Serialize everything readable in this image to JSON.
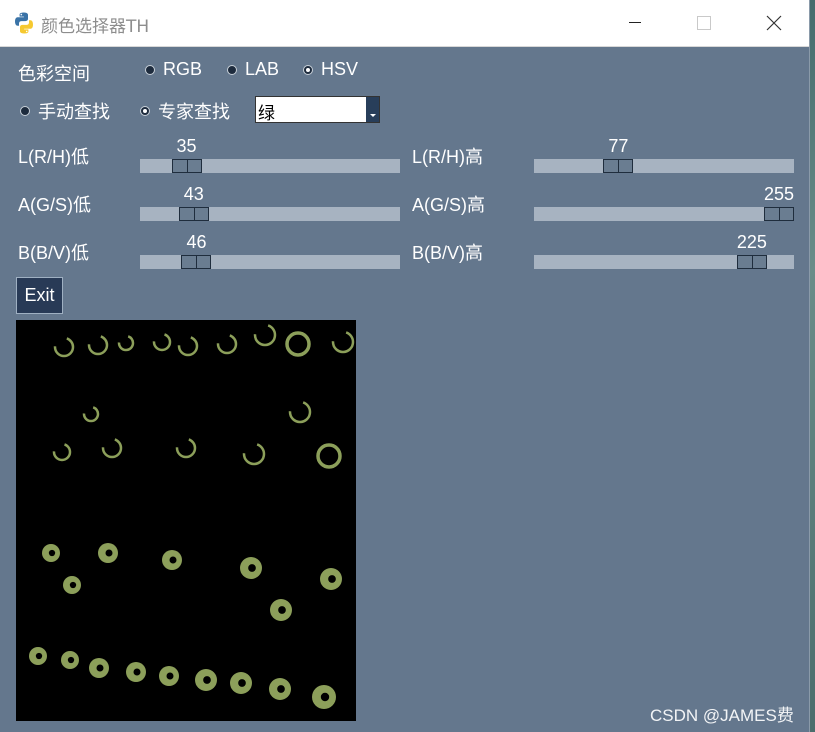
{
  "window": {
    "title": "颜色选择器TH"
  },
  "color_space": {
    "label": "色彩空间",
    "options": [
      {
        "label": "RGB",
        "selected": false
      },
      {
        "label": "LAB",
        "selected": false
      },
      {
        "label": "HSV",
        "selected": true
      }
    ]
  },
  "mode": {
    "options": [
      {
        "label": "手动查找",
        "selected": false
      },
      {
        "label": "专家查找",
        "selected": true
      }
    ],
    "combo_value": "绿"
  },
  "sliders": [
    {
      "label": "L(R/H)低",
      "value": 35,
      "max": 255
    },
    {
      "label": "L(R/H)高",
      "value": 77,
      "max": 255
    },
    {
      "label": "A(G/S)低",
      "value": 43,
      "max": 255
    },
    {
      "label": "A(G/S)高",
      "value": 255,
      "max": 255
    },
    {
      "label": "B(B/V)低",
      "value": 46,
      "max": 255
    },
    {
      "label": "B(B/V)高",
      "value": 225,
      "max": 255
    }
  ],
  "exit_label": "Exit",
  "watermark": "CSDN @JAMES费",
  "colors": {
    "window_bg": "#64778d",
    "track": "#a7b3c1",
    "blob": "#8c9f5a"
  }
}
